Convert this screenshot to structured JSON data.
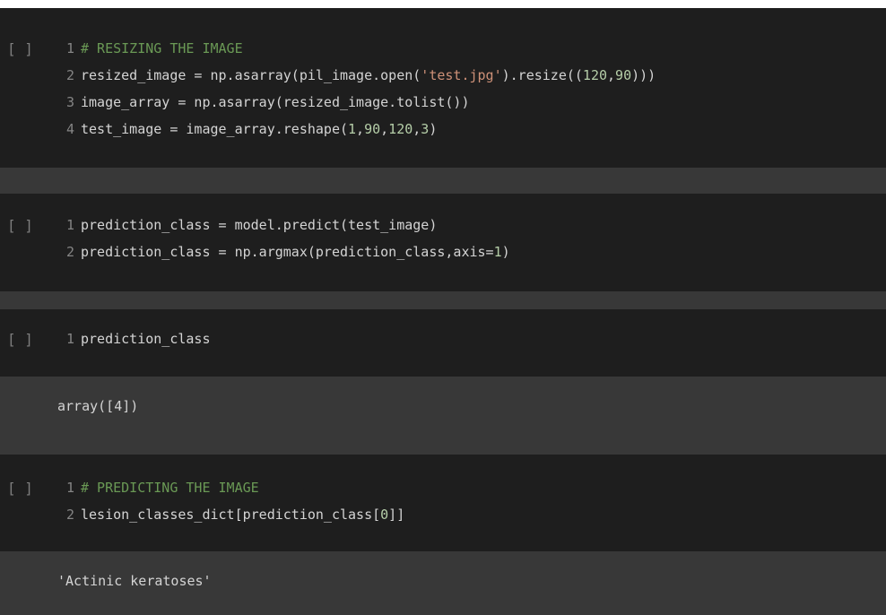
{
  "run_button_label": "[ ]",
  "cells": [
    {
      "lines": [
        {
          "num": "1",
          "tokens": [
            {
              "t": "# RESIZING THE IMAGE",
              "c": "comment"
            }
          ]
        },
        {
          "num": "2",
          "tokens": [
            {
              "t": "resized_image = np.asarray(pil_image.open(",
              "c": "plain"
            },
            {
              "t": "'test.jpg'",
              "c": "string"
            },
            {
              "t": ").resize((",
              "c": "plain"
            },
            {
              "t": "120",
              "c": "number"
            },
            {
              "t": ",",
              "c": "plain"
            },
            {
              "t": "90",
              "c": "number"
            },
            {
              "t": ")))",
              "c": "plain"
            }
          ]
        },
        {
          "num": "3",
          "tokens": [
            {
              "t": "image_array = np.asarray(resized_image.tolist())",
              "c": "plain"
            }
          ]
        },
        {
          "num": "4",
          "tokens": [
            {
              "t": "test_image = image_array.reshape(",
              "c": "plain"
            },
            {
              "t": "1",
              "c": "number"
            },
            {
              "t": ",",
              "c": "plain"
            },
            {
              "t": "90",
              "c": "number"
            },
            {
              "t": ",",
              "c": "plain"
            },
            {
              "t": "120",
              "c": "number"
            },
            {
              "t": ",",
              "c": "plain"
            },
            {
              "t": "3",
              "c": "number"
            },
            {
              "t": ")",
              "c": "plain"
            }
          ]
        }
      ]
    },
    {
      "lines": [
        {
          "num": "1",
          "tokens": [
            {
              "t": "prediction_class = model.predict(test_image)",
              "c": "plain"
            }
          ]
        },
        {
          "num": "2",
          "tokens": [
            {
              "t": "prediction_class = np.argmax(prediction_class,axis=",
              "c": "plain"
            },
            {
              "t": "1",
              "c": "number"
            },
            {
              "t": ")",
              "c": "plain"
            }
          ]
        }
      ]
    },
    {
      "lines": [
        {
          "num": "1",
          "tokens": [
            {
              "t": "prediction_class",
              "c": "plain"
            }
          ]
        }
      ],
      "output": "array([4])"
    },
    {
      "lines": [
        {
          "num": "1",
          "tokens": [
            {
              "t": "# PREDICTING THE IMAGE",
              "c": "comment"
            }
          ]
        },
        {
          "num": "2",
          "tokens": [
            {
              "t": "lesion_classes_dict[prediction_class[",
              "c": "plain"
            },
            {
              "t": "0",
              "c": "number"
            },
            {
              "t": "]]",
              "c": "plain"
            }
          ]
        }
      ],
      "output": "'Actinic keratoses'"
    }
  ],
  "colors": {
    "cell_background": "#1e1e1e",
    "output_background": "#383838",
    "plain": "#d4d4d4",
    "comment": "#6a9955",
    "string": "#ce9178",
    "number": "#b5cea8",
    "line_number": "#858585"
  }
}
